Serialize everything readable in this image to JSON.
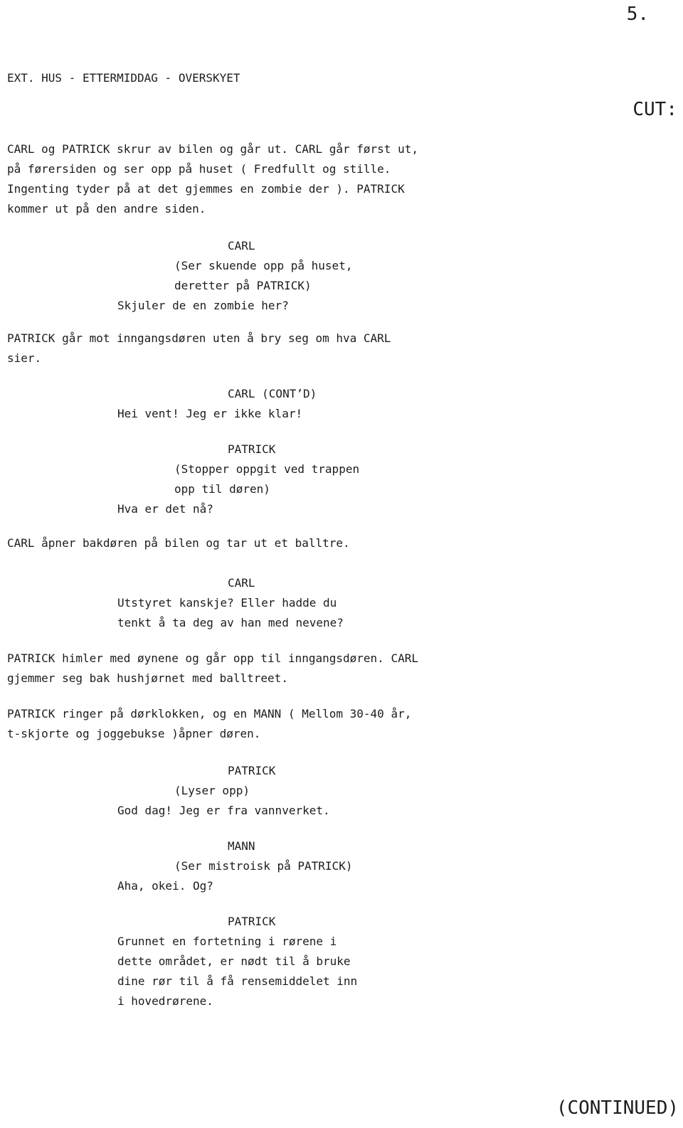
{
  "document": {
    "type": "screenplay",
    "page_number": "5.",
    "continued_marker": "(CONTINUED)"
  },
  "scene_heading": "EXT. HUS - ETTERMIDDAG - OVERSKYET",
  "transition": "CUT:",
  "blocks": {
    "action_1": {
      "l1": "CARL og PATRICK skrur av bilen og går ut. CARL går først ut,",
      "l2": "på førersiden og ser opp på huset ( Fredfullt og stille.",
      "l3": "Ingenting tyder på at det gjemmes en zombie der ). PATRICK",
      "l4": "kommer ut på den andre siden."
    },
    "dialogue_1": {
      "character": "CARL",
      "paren_l1": "(Ser skuende opp på huset,",
      "paren_l2": "deretter på PATRICK)",
      "line_1": "Skjuler de en zombie her?"
    },
    "action_2": {
      "l1": "PATRICK går mot inngangsdøren uten å bry seg om hva CARL",
      "l2": "sier."
    },
    "dialogue_2": {
      "character": "CARL (CONT’D)",
      "line_1": "Hei vent! Jeg er ikke klar!"
    },
    "dialogue_3": {
      "character": "PATRICK",
      "paren_l1": "(Stopper oppgit ved trappen",
      "paren_l2": "opp til døren)",
      "line_1": "Hva er det nå?"
    },
    "action_3": {
      "l1": "CARL åpner bakdøren på bilen og tar ut et balltre."
    },
    "dialogue_4": {
      "character": "CARL",
      "line_1": "Utstyret kanskje? Eller hadde du",
      "line_2": "tenkt å ta deg av han med nevene?"
    },
    "action_4": {
      "l1": "PATRICK himler med øynene og går opp til inngangsdøren. CARL",
      "l2": "gjemmer seg bak hushjørnet med balltreet."
    },
    "action_5": {
      "l1": "PATRICK ringer på dørklokken, og en MANN ( Mellom 30-40 år,",
      "l2": "t-skjorte og joggebukse )åpner døren."
    },
    "dialogue_5": {
      "character": "PATRICK",
      "paren_l1": "(Lyser opp)",
      "line_1": "God dag! Jeg er fra vannverket."
    },
    "dialogue_6": {
      "character": "MANN",
      "paren_l1": "(Ser mistroisk på PATRICK)",
      "line_1": "Aha, okei. Og?"
    },
    "dialogue_7": {
      "character": "PATRICK",
      "line_1": "Grunnet en fortetning i rørene i",
      "line_2": "dette området, er nødt til å bruke",
      "line_3": "dine rør til å få rensemiddelet inn",
      "line_4": "i hovedrørene."
    }
  }
}
